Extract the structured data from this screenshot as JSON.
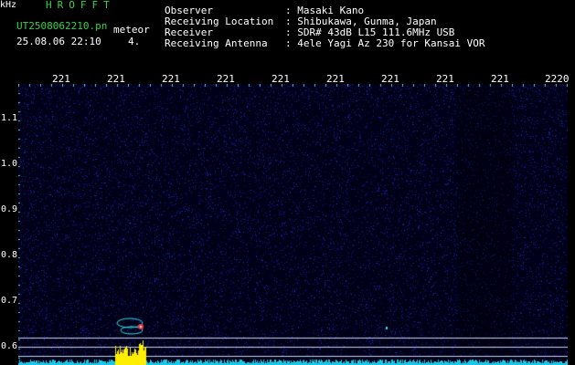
{
  "header": {
    "brand": "HROFFT",
    "filename": "UT2508062210.pn",
    "meteor_label": "meteor",
    "datetime": "25.08.06 22:10",
    "count": "4."
  },
  "info": [
    {
      "label": "Observer",
      "value": ": Masaki Kano"
    },
    {
      "label": "Receiving Location",
      "value": ": Shibukawa, Gunma, Japan"
    },
    {
      "label": "Receiver",
      "value": ": SDR# 43dB L15 111.6MHz USB"
    },
    {
      "label": "Receiving Antenna",
      "value": ": 4ele Yagi Az 230 for Kansai VOR"
    }
  ],
  "spectrogram": {
    "unit": "kHz",
    "x_ticks": [
      "221",
      "221",
      "221",
      "221",
      "221",
      "221",
      "221",
      "221",
      "221",
      "2220"
    ],
    "y_ticks": [
      "1.1",
      "1.0",
      "0.9",
      "0.8",
      "0.7",
      "0.6"
    ],
    "colors": {
      "background": "#000018",
      "noise": "#1a2ad0",
      "echo": "#30e0e0",
      "spectrum": "#19c8e6",
      "peak": "#ffee00",
      "tick": "#5fc4e8"
    }
  }
}
